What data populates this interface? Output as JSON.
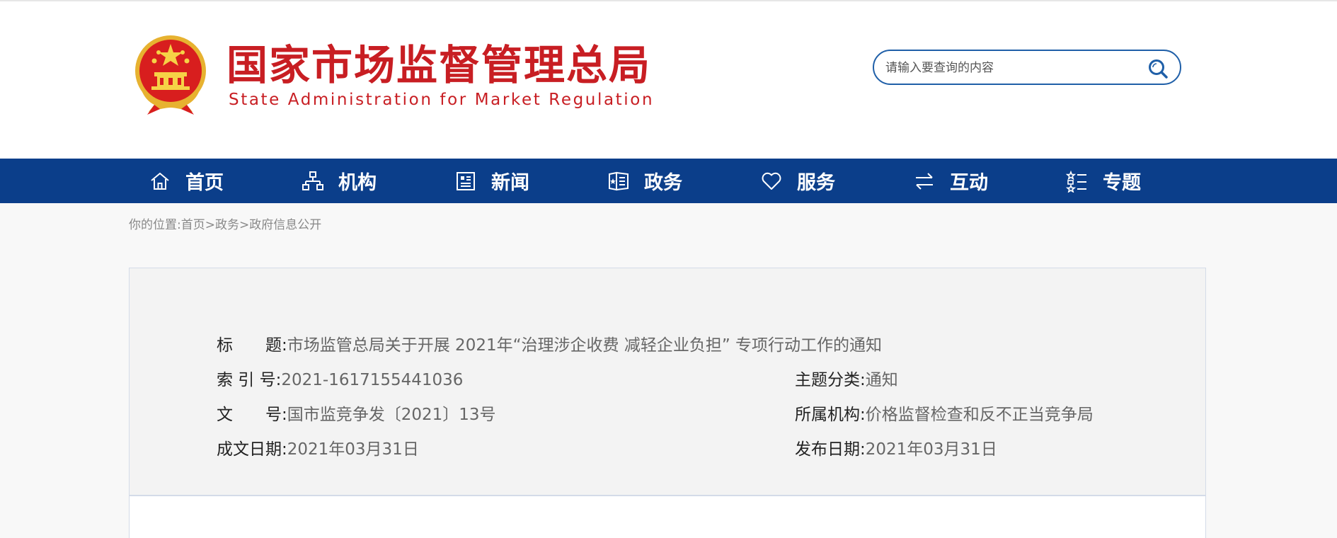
{
  "site": {
    "name_cn": "国家市场监督管理总局",
    "name_en": "State Administration for Market Regulation",
    "emblem_icon": "national-emblem",
    "brand_color": "#c81e23",
    "nav_color": "#0b3e8a"
  },
  "search": {
    "placeholder": "请输入要查询的内容",
    "value": "",
    "icon": "search-icon"
  },
  "nav": {
    "items": [
      {
        "label": "首页",
        "icon": "home-icon"
      },
      {
        "label": "机构",
        "icon": "organization-icon"
      },
      {
        "label": "新闻",
        "icon": "news-icon"
      },
      {
        "label": "政务",
        "icon": "government-icon"
      },
      {
        "label": "服务",
        "icon": "heart-icon"
      },
      {
        "label": "互动",
        "icon": "exchange-icon"
      },
      {
        "label": "专题",
        "icon": "list-icon"
      }
    ]
  },
  "breadcrumb": {
    "prefix": "你的位置:",
    "items": [
      "首页",
      "政务",
      "政府信息公开"
    ],
    "separator": ">"
  },
  "info": {
    "title_label": "标　　题:",
    "title_value": "市场监管总局关于开展 2021年“治理涉企收费 减轻企业负担” 专项行动工作的通知",
    "index_label": "索 引 号:",
    "index_value": "2021-1617155441036",
    "topic_label": "主题分类:",
    "topic_value": "通知",
    "doc_label": "文　　号:",
    "doc_value": "国市监竞争发〔2021〕13号",
    "org_label": "所属机构:",
    "org_value": "价格监督检查和反不正当竞争局",
    "date_label": "成文日期:",
    "date_value": "2021年03月31日",
    "publish_label": "发布日期:",
    "publish_value": "2021年03月31日"
  }
}
